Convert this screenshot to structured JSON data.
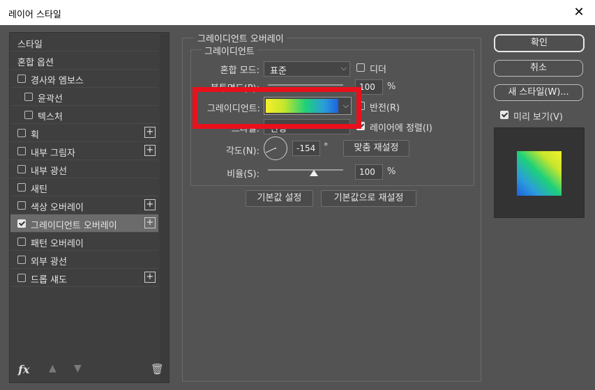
{
  "window": {
    "title": "레이어 스타일",
    "close_glyph": "✕"
  },
  "left_list": {
    "items": [
      {
        "label": "스타일",
        "has_checkbox": false,
        "checked": false,
        "indent": false,
        "has_plus": false,
        "selected": false
      },
      {
        "label": "혼합 옵션",
        "has_checkbox": false,
        "checked": false,
        "indent": false,
        "has_plus": false,
        "selected": false
      },
      {
        "label": "경사와 엠보스",
        "has_checkbox": true,
        "checked": false,
        "indent": false,
        "has_plus": false,
        "selected": false
      },
      {
        "label": "윤곽선",
        "has_checkbox": true,
        "checked": false,
        "indent": true,
        "has_plus": false,
        "selected": false
      },
      {
        "label": "텍스처",
        "has_checkbox": true,
        "checked": false,
        "indent": true,
        "has_plus": false,
        "selected": false
      },
      {
        "label": "획",
        "has_checkbox": true,
        "checked": false,
        "indent": false,
        "has_plus": true,
        "selected": false
      },
      {
        "label": "내부 그림자",
        "has_checkbox": true,
        "checked": false,
        "indent": false,
        "has_plus": true,
        "selected": false
      },
      {
        "label": "내부 광선",
        "has_checkbox": true,
        "checked": false,
        "indent": false,
        "has_plus": false,
        "selected": false
      },
      {
        "label": "새틴",
        "has_checkbox": true,
        "checked": false,
        "indent": false,
        "has_plus": false,
        "selected": false
      },
      {
        "label": "색상 오버레이",
        "has_checkbox": true,
        "checked": false,
        "indent": false,
        "has_plus": true,
        "selected": false
      },
      {
        "label": "그레이디언트 오버레이",
        "has_checkbox": true,
        "checked": true,
        "indent": false,
        "has_plus": true,
        "selected": true
      },
      {
        "label": "패턴 오버레이",
        "has_checkbox": true,
        "checked": false,
        "indent": false,
        "has_plus": false,
        "selected": false
      },
      {
        "label": "외부 광선",
        "has_checkbox": true,
        "checked": false,
        "indent": false,
        "has_plus": false,
        "selected": false
      },
      {
        "label": "드롭 섀도",
        "has_checkbox": true,
        "checked": false,
        "indent": false,
        "has_plus": true,
        "selected": false
      }
    ],
    "plus_glyph": "+",
    "icons": {
      "fx": "fx",
      "up": "▲",
      "down": "▼",
      "trash": "🗑"
    }
  },
  "gradient_overlay": {
    "group_title": "그레이디언트 오버레이",
    "sub_title": "그레이디언트",
    "blend_mode_label": "혼합 모드:",
    "blend_mode_value": "표준",
    "dither_label": "디더",
    "opacity_label": "불투명도(P):",
    "opacity_value": "100",
    "percent": "%",
    "gradient_label": "그레이디언트:",
    "reverse_label": "반전(R)",
    "style_label": "스타일:",
    "style_value": "선형",
    "align_label": "레이어에 정렬(I)",
    "align_checked": true,
    "angle_label": "각도(N):",
    "angle_value": "-154",
    "degree": "°",
    "reset_align_label": "맞춤 재설정",
    "scale_label": "비율(S):",
    "scale_value": "100",
    "make_default_label": "기본값 설정",
    "reset_default_label": "기본값으로 재설정"
  },
  "right": {
    "ok_label": "확인",
    "cancel_label": "취소",
    "new_style_label": "새 스타일(W)...",
    "preview_label": "미리 보기(V)",
    "preview_checked": true
  },
  "chevron_glyph": "⌵"
}
